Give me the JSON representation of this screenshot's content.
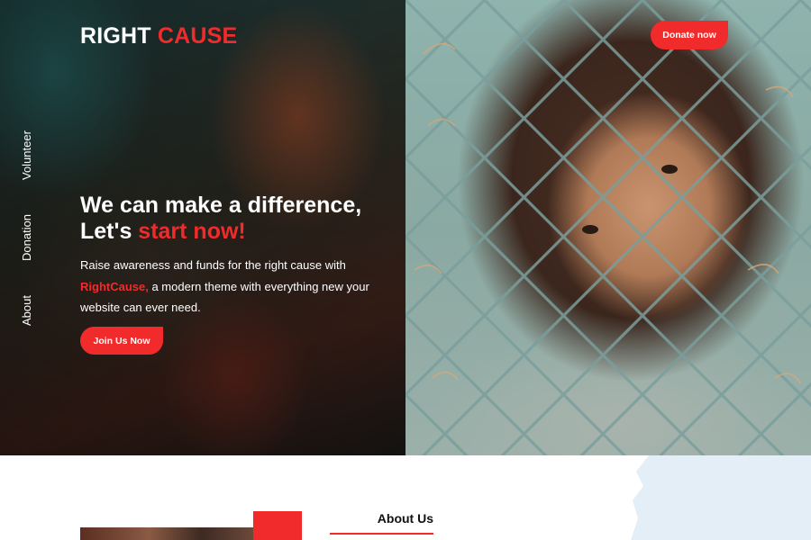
{
  "brand": {
    "part1": "RIGHT ",
    "part2": "CAUSE"
  },
  "nav": {
    "donate_label": "Donate now"
  },
  "side_nav": [
    "Volunteer",
    "Donation",
    "About"
  ],
  "hero": {
    "headline_line1": "We can make a difference,",
    "headline_line2_prefix": "Let's ",
    "headline_line2_accent": "start now!",
    "lead_prefix": "Raise awareness and funds for the right cause with",
    "lead_accent": "RightCause,",
    "lead_suffix": " a modern theme with everything new your website can ever need.",
    "cta_label": "Join Us Now"
  },
  "about": {
    "title": "About Us"
  },
  "colors": {
    "accent": "#f12b2b",
    "text_light": "#ffffff",
    "text_dark": "#111111"
  }
}
